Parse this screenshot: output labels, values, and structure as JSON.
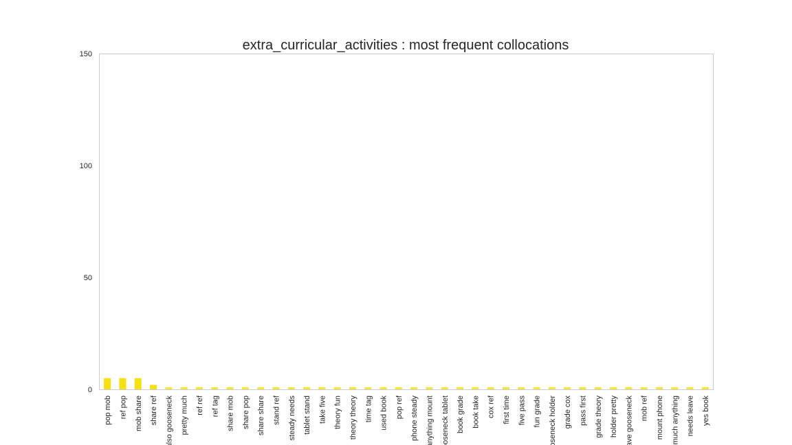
{
  "chart_data": {
    "type": "bar",
    "title": "extra_curricular_activities : most frequent collocations",
    "xlabel": "",
    "ylabel": "",
    "ylim": [
      0,
      150
    ],
    "yticks": [
      "0",
      "50",
      "100",
      "150"
    ],
    "grid": false,
    "categories": [
      "pop mob",
      "ref pop",
      "mob share",
      "share ref",
      "also gooseneck",
      "pretty much",
      "ref ref",
      "ref tag",
      "share mob",
      "share pop",
      "share share",
      "stand ref",
      "steady needs",
      "tablet stand",
      "take five",
      "theory fun",
      "theory theory",
      "time tag",
      "used book",
      "pop ref",
      "phone steady",
      "anything mount",
      "gooseneck tablet",
      "book grade",
      "book take",
      "cox ref",
      "first time",
      "five pass",
      "fun grade",
      "gooseneck holder",
      "grade cox",
      "pass first",
      "grade theory",
      "holder pretty",
      "leave gooseneck",
      "mob ref",
      "mount phone",
      "much anything",
      "needs leave",
      "yes book"
    ],
    "values": [
      5,
      5,
      5,
      2,
      1,
      1,
      1,
      1,
      1,
      1,
      1,
      1,
      1,
      1,
      1,
      1,
      1,
      1,
      1,
      1,
      1,
      1,
      1,
      1,
      1,
      1,
      1,
      1,
      1,
      1,
      1,
      1,
      1,
      1,
      1,
      1,
      1,
      1,
      1,
      1
    ],
    "colors": [
      "#f5e10f",
      "#f5e10f",
      "#f5e10f",
      "#f5e10f",
      "#f5e441",
      "#f5e441",
      "#f5e441",
      "#f5e441",
      "#f5e441",
      "#f5e441",
      "#f5e441",
      "#f5e441",
      "#f5e441",
      "#f5e441",
      "#f5e441",
      "#f5e441",
      "#f5e441",
      "#f5e441",
      "#f5e441",
      "#f5e441",
      "#f5e441",
      "#f5e441",
      "#f5e441",
      "#f5e441",
      "#f5e441",
      "#f5e441",
      "#f5e441",
      "#f5e441",
      "#f5e441",
      "#f5e441",
      "#f5e441",
      "#f5e441",
      "#f5e441",
      "#f5e441",
      "#f5e441",
      "#f5e441",
      "#f5e441",
      "#f5e441",
      "#f5e441",
      "#f5e441"
    ]
  }
}
